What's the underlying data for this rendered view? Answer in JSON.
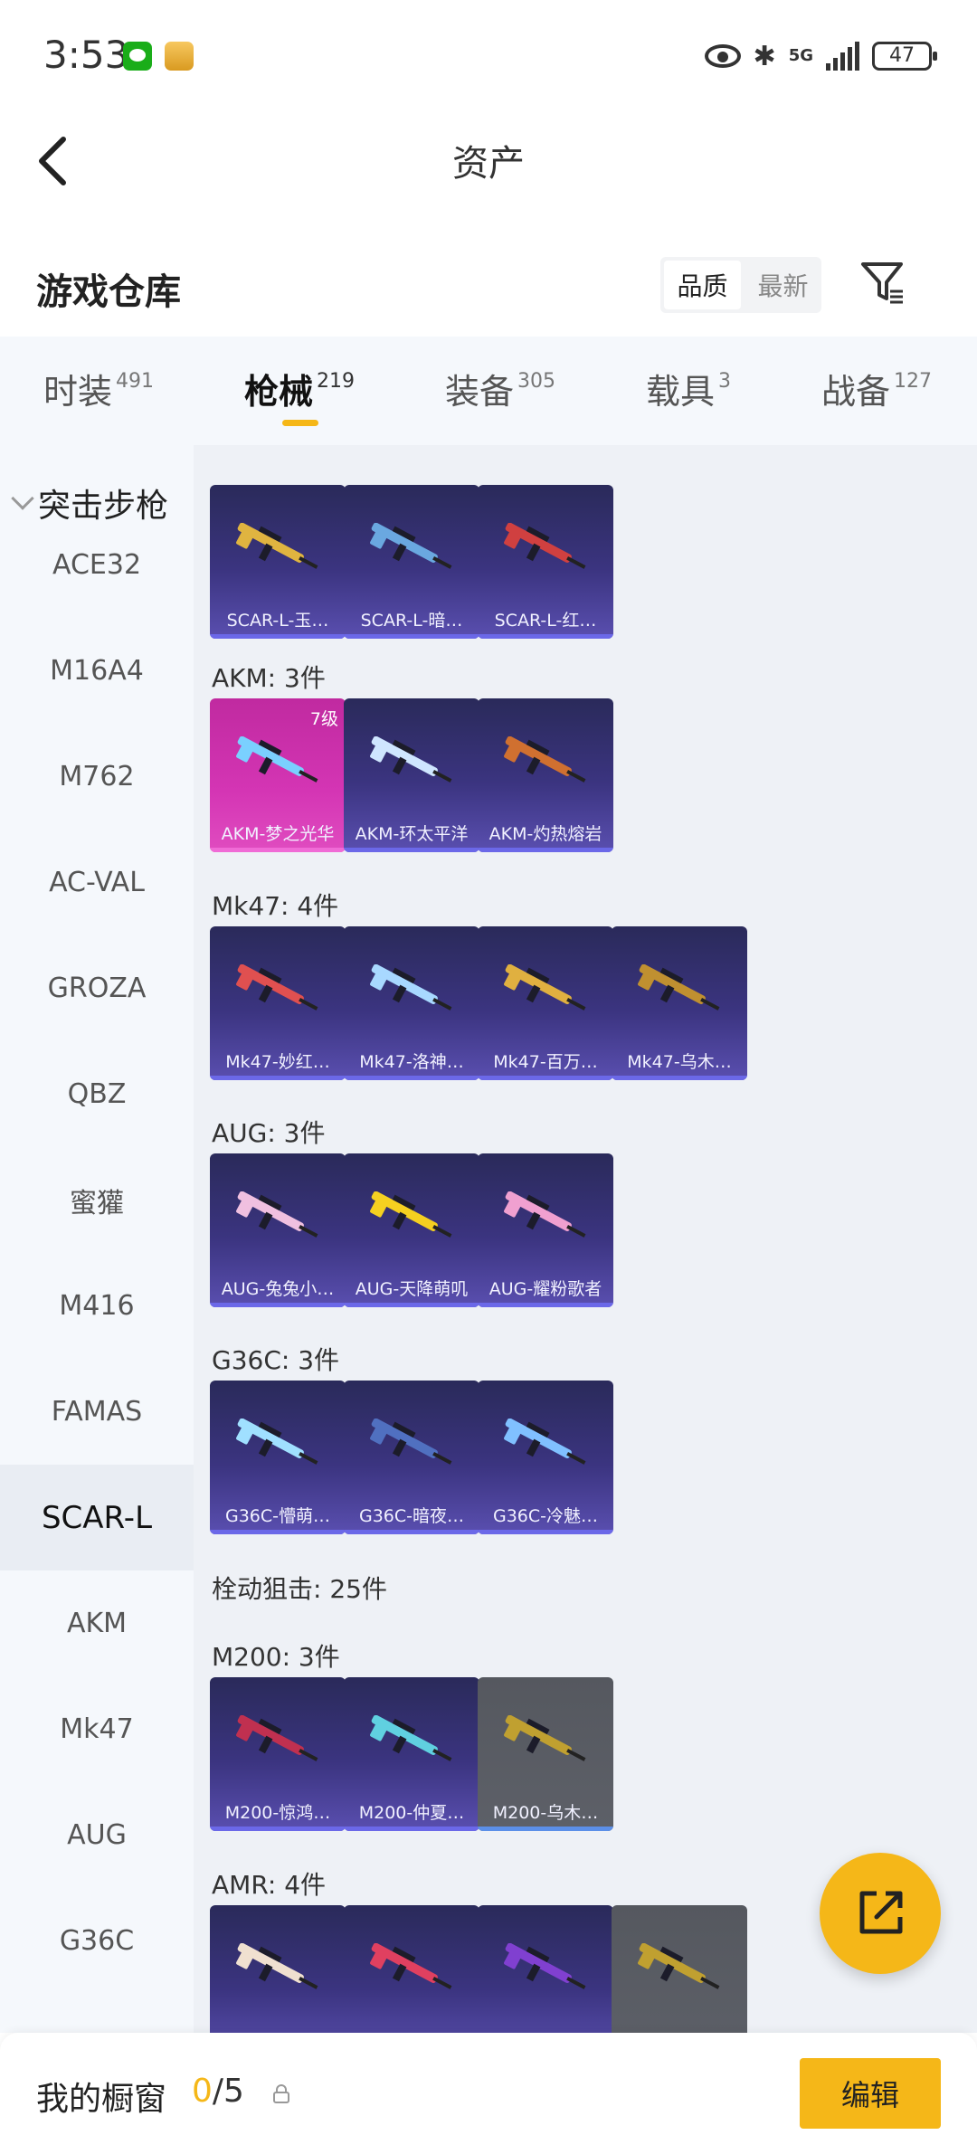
{
  "status": {
    "time": "3:53",
    "battery": "47",
    "network": "5G"
  },
  "header": {
    "title": "资产"
  },
  "warehouse": {
    "title": "游戏仓库",
    "sort_options": [
      "品质",
      "最新"
    ],
    "sort_active": "品质"
  },
  "tabs": [
    {
      "label": "时装",
      "count": "491"
    },
    {
      "label": "枪械",
      "count": "219"
    },
    {
      "label": "装备",
      "count": "305"
    },
    {
      "label": "载具",
      "count": "3"
    },
    {
      "label": "战备",
      "count": "127"
    }
  ],
  "sidebar": {
    "category": "突击步枪",
    "items": [
      "ACE32",
      "M16A4",
      "M762",
      "AC-VAL",
      "GROZA",
      "QBZ",
      "蜜獾",
      "M416",
      "FAMAS",
      "SCAR-L",
      "AKM",
      "Mk47",
      "AUG",
      "G36C"
    ],
    "active": "SCAR-L"
  },
  "groups": [
    {
      "title": "",
      "items": [
        "SCAR-L-玉…",
        "SCAR-L-暗…",
        "SCAR-L-红…"
      ]
    },
    {
      "title": "AKM: 3件",
      "items": [
        "AKM-梦之光华",
        "AKM-环太平洋",
        "AKM-灼热熔岩"
      ],
      "badge": "7级"
    },
    {
      "title": "Mk47: 4件",
      "items": [
        "Mk47-妙红…",
        "Mk47-洛神…",
        "Mk47-百万…",
        "Mk47-乌木…"
      ]
    },
    {
      "title": "AUG: 3件",
      "items": [
        "AUG-兔兔小…",
        "AUG-天降萌叽",
        "AUG-耀粉歌者"
      ]
    },
    {
      "title": "G36C: 3件",
      "items": [
        "G36C-懵萌…",
        "G36C-暗夜…",
        "G36C-冷魅…"
      ]
    },
    {
      "title": "栓动狙击: 25件",
      "items": []
    },
    {
      "title": "M200: 3件",
      "items": [
        "M200-惊鸿…",
        "M200-仲夏…",
        "M200-乌木…"
      ]
    },
    {
      "title": "AMR: 4件",
      "items": [
        "",
        "",
        "",
        ""
      ]
    }
  ],
  "bottom": {
    "label": "我的橱窗",
    "current": "0",
    "total": "/5",
    "edit_label": "编辑"
  },
  "colors": {
    "accent": "#f5b718",
    "card_purple": "#3b3480",
    "card_pink": "#d435b4"
  }
}
